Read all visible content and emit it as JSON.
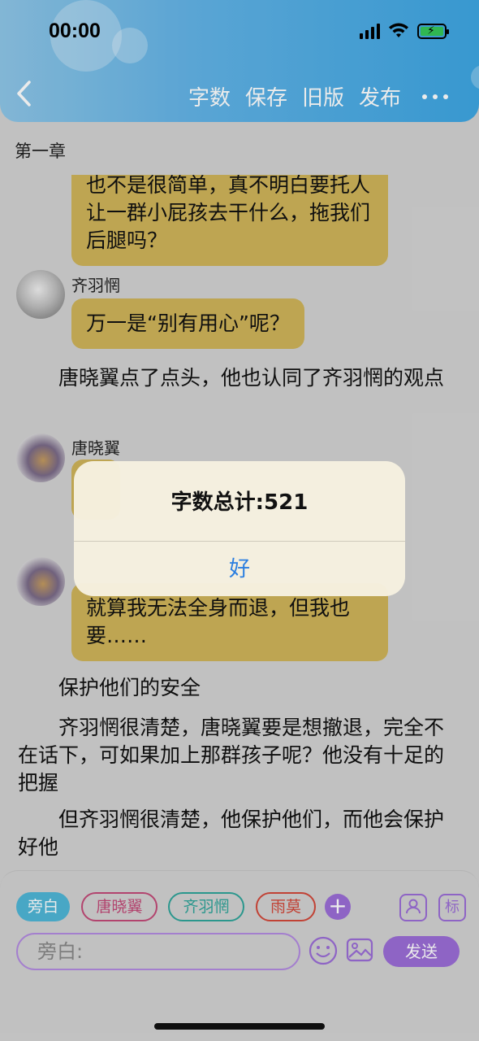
{
  "status": {
    "time": "00:00"
  },
  "header": {
    "back_icon": "chevron-left-icon",
    "actions": [
      "字数",
      "保存",
      "旧版",
      "发布"
    ],
    "more_icon": "more-dots-icon"
  },
  "chapter": {
    "title": "第一章"
  },
  "messages": [
    {
      "text": "也不是很简单，真不明白要托人让一群小屁孩去干什么，拖我们后腿吗？"
    },
    {
      "speaker": "齐羽惘",
      "text": "万一是“别有用心”呢？"
    },
    {
      "narration": "唐晓翼点了点头，他也认同了齐羽惘的观点"
    },
    {
      "speaker": "唐晓翼",
      "text": ""
    },
    {
      "text": "就算我无法全身而退，但我也要……"
    },
    {
      "narration": "保护他们的安全"
    },
    {
      "narration": "齐羽惘很清楚，唐晓翼要是想撤退，完全不在话下，可如果加上那群孩子呢？他没有十足的把握"
    },
    {
      "narration": "但齐羽惘很清楚，他保护他们，而他会保护好他"
    }
  ],
  "dialog": {
    "title": "字数总计:521",
    "ok_label": "好"
  },
  "bottom": {
    "chips": [
      "旁白",
      "唐晓翼",
      "齐羽惘",
      "雨莫"
    ],
    "add_label": "+",
    "tag_label": "标",
    "input_placeholder": "旁白:",
    "send_label": "发送"
  },
  "colors": {
    "header_gradient_end": "#3da6e2",
    "bubble": "#cfb459",
    "accent_purple": "#9b6dd6",
    "link_blue": "#2a7ee0"
  }
}
